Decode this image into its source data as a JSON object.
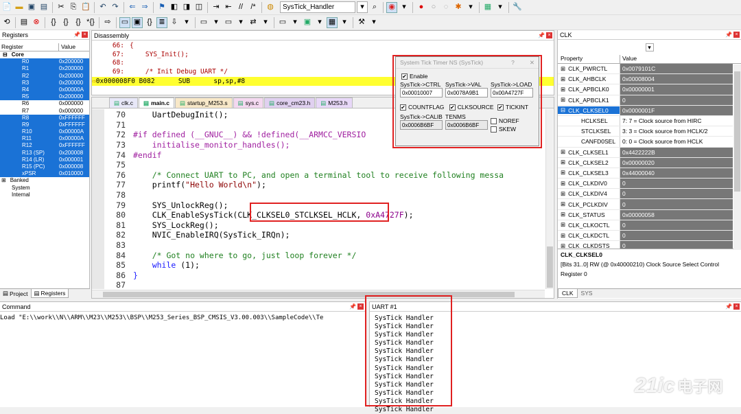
{
  "toolbar": {
    "target_combo": "SysTick_Handler"
  },
  "registers": {
    "title": "Registers",
    "col_register": "Register",
    "col_value": "Value",
    "core": "Core",
    "rows": [
      {
        "name": "R0",
        "value": "0x200000",
        "sel": true
      },
      {
        "name": "R1",
        "value": "0x200000",
        "sel": true
      },
      {
        "name": "R2",
        "value": "0x200000",
        "sel": true
      },
      {
        "name": "R3",
        "value": "0x200000",
        "sel": true
      },
      {
        "name": "R4",
        "value": "0x00000A",
        "sel": true
      },
      {
        "name": "R5",
        "value": "0x200000",
        "sel": true
      },
      {
        "name": "R6",
        "value": "0x000000",
        "sel": false
      },
      {
        "name": "R7",
        "value": "0x000000",
        "sel": false
      },
      {
        "name": "R8",
        "value": "0xFFFFFF",
        "sel": true
      },
      {
        "name": "R9",
        "value": "0xFFFFFF",
        "sel": true
      },
      {
        "name": "R10",
        "value": "0x00000A",
        "sel": true
      },
      {
        "name": "R11",
        "value": "0x00000A",
        "sel": true
      },
      {
        "name": "R12",
        "value": "0xFFFFFF",
        "sel": true
      },
      {
        "name": "R13 (SP)",
        "value": "0x200008",
        "sel": true
      },
      {
        "name": "R14 (LR)",
        "value": "0x000001",
        "sel": true
      },
      {
        "name": "R15 (PC)",
        "value": "0x000008",
        "sel": true
      },
      {
        "name": "xPSR",
        "value": "0x010000",
        "sel": true
      }
    ],
    "banked": "Banked",
    "system": "System",
    "internal": "Internal",
    "tab_project": "Project",
    "tab_registers": "Registers"
  },
  "disasm": {
    "title": "Disassembly",
    "lines": [
      {
        "num": "66:",
        "text": "{"
      },
      {
        "num": "67:",
        "text": "    SYS_Init();"
      },
      {
        "num": "68:",
        "text": ""
      },
      {
        "num": "69:",
        "text": "    /* Init Debug UART */"
      }
    ],
    "current": {
      "addr": "0x000008F0",
      "op": "B082",
      "mn": "SUB",
      "args": "sp,sp,#8"
    }
  },
  "tabs": [
    "clk.c",
    "main.c",
    "startup_M253.s",
    "sys.c",
    "core_cm23.h",
    "M253.h"
  ],
  "code": [
    {
      "n": "70",
      "parts": [
        [
          "",
          "    UartDebugInit();"
        ]
      ]
    },
    {
      "n": "71",
      "parts": [
        [
          "",
          ""
        ]
      ]
    },
    {
      "n": "72",
      "parts": [
        [
          "pp",
          "#if defined (__GNUC__) && !defined(__ARMCC_VERSIO"
        ]
      ]
    },
    {
      "n": "73",
      "parts": [
        [
          "pp",
          "    initialise_monitor_handles();"
        ]
      ]
    },
    {
      "n": "74",
      "parts": [
        [
          "pp",
          "#endif"
        ]
      ]
    },
    {
      "n": "75",
      "parts": [
        [
          "",
          ""
        ]
      ]
    },
    {
      "n": "76",
      "parts": [
        [
          "cm",
          "    /* Connect UART to PC, and open a terminal tool to receive following messa"
        ]
      ]
    },
    {
      "n": "77",
      "parts": [
        [
          "",
          "    printf("
        ],
        [
          "str",
          "\"Hello World\\n\""
        ],
        [
          "",
          ");"
        ]
      ]
    },
    {
      "n": "78",
      "parts": [
        [
          "",
          ""
        ]
      ]
    },
    {
      "n": "79",
      "parts": [
        [
          "",
          "    SYS_UnlockReg();"
        ]
      ]
    },
    {
      "n": "80",
      "parts": [
        [
          "",
          "    CLK_EnableSysTick(CLK_CLKSEL0_STCLKSEL_HCLK, "
        ],
        [
          "hex",
          "0xA4727F"
        ],
        [
          "",
          ");"
        ]
      ]
    },
    {
      "n": "81",
      "parts": [
        [
          "",
          "    SYS_LockReg();"
        ]
      ]
    },
    {
      "n": "82",
      "parts": [
        [
          "",
          "    NVIC_EnableIRQ(SysTick_IRQn);"
        ]
      ]
    },
    {
      "n": "83",
      "parts": [
        [
          "",
          ""
        ]
      ]
    },
    {
      "n": "84",
      "parts": [
        [
          "cm",
          "    /* Got no where to go, just loop forever */"
        ]
      ]
    },
    {
      "n": "85",
      "parts": [
        [
          "kw",
          "    while"
        ],
        [
          "",
          " (1);"
        ]
      ]
    },
    {
      "n": "86",
      "parts": [
        [
          "kw",
          "}"
        ]
      ]
    },
    {
      "n": "87",
      "parts": [
        [
          "",
          ""
        ]
      ]
    }
  ],
  "systick": {
    "title": "System Tick Timer NS (SysTick)",
    "help": "?",
    "enable": "Enable",
    "ctrl_label": "SysTick->CTRL",
    "ctrl": "0x00010007",
    "val_label": "SysTick->VAL",
    "val": "0x0078A9B1",
    "load_label": "SysTick->LOAD",
    "load": "0x00A4727F",
    "countflag": "COUNTFLAG",
    "clksource": "CLKSOURCE",
    "tickint": "TICKINT",
    "calib_label": "SysTick->CALIB",
    "calib": "0x0006B6BF",
    "tenms_label": "TENMS",
    "tenms": "0x0006B6BF",
    "noref": "NOREF",
    "skew": "SKEW"
  },
  "clk": {
    "title": "CLK",
    "col_property": "Property",
    "col_value": "Value",
    "rows": [
      {
        "name": "CLK_PWRCTL",
        "value": "0x0079101C",
        "type": "top"
      },
      {
        "name": "CLK_AHBCLK",
        "value": "0x00008004",
        "type": "top"
      },
      {
        "name": "CLK_APBCLK0",
        "value": "0x00000001",
        "type": "top"
      },
      {
        "name": "CLK_APBCLK1",
        "value": "0",
        "type": "top"
      },
      {
        "name": "CLK_CLKSEL0",
        "value": "0x0000001F",
        "type": "sel"
      },
      {
        "name": "HCLKSEL",
        "value": "7: 7 = Clock source from HIRC",
        "type": "sub"
      },
      {
        "name": "STCLKSEL",
        "value": "3: 3 = Clock source from HCLK/2",
        "type": "sub"
      },
      {
        "name": "CANFD0SEL",
        "value": "0: 0 = Clock source from HCLK",
        "type": "sub"
      },
      {
        "name": "CLK_CLKSEL1",
        "value": "0x4422222B",
        "type": "top"
      },
      {
        "name": "CLK_CLKSEL2",
        "value": "0x00000020",
        "type": "top"
      },
      {
        "name": "CLK_CLKSEL3",
        "value": "0x44000040",
        "type": "top"
      },
      {
        "name": "CLK_CLKDIV0",
        "value": "0",
        "type": "top"
      },
      {
        "name": "CLK_CLKDIV4",
        "value": "0",
        "type": "top"
      },
      {
        "name": "CLK_PCLKDIV",
        "value": "0",
        "type": "top"
      },
      {
        "name": "CLK_STATUS",
        "value": "0x00000058",
        "type": "top"
      },
      {
        "name": "CLK_CLKOCTL",
        "value": "0",
        "type": "top"
      },
      {
        "name": "CLK_CLKDCTL",
        "value": "0",
        "type": "top"
      },
      {
        "name": "CLK_CLKDSTS",
        "value": "0",
        "type": "top"
      }
    ],
    "desc_title": "CLK_CLKSEL0",
    "desc_line": "[Bits 31..0] RW (@ 0x40000210) Clock Source Select Control",
    "desc_reg": "Register 0",
    "tab_clk": "CLK",
    "tab_sys": "SYS"
  },
  "command": {
    "title": "Command",
    "line": "Load \"E:\\\\work\\\\N\\\\ARM\\\\M23\\\\M253\\\\BSP\\\\M253_Series_BSP_CMSIS_V3.00.003\\\\SampleCode\\\\Te"
  },
  "uart": {
    "title": "UART #1",
    "lines": [
      "SysTick Handler",
      "SysTick Handler",
      "SysTick Handler",
      "SysTick Handler",
      "SysTick Handler",
      "SysTick Handler",
      "SysTick Handler",
      "SysTick Handler",
      "SysTick Handler",
      "SysTick Handler",
      "SysTick Handler",
      "SysTick Handler"
    ]
  },
  "watermark": {
    "a": "21ic",
    "b": "电子网"
  }
}
